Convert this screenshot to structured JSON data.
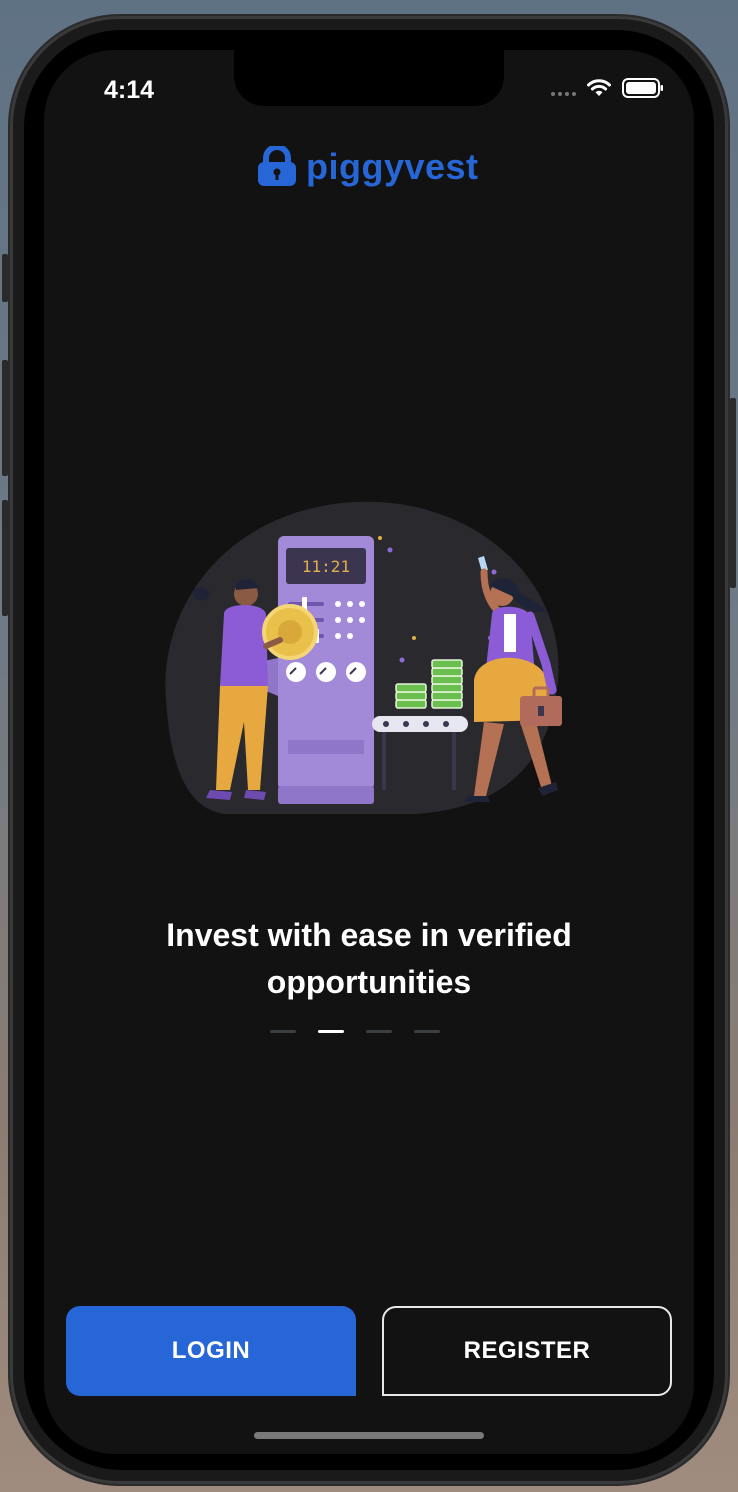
{
  "status_bar": {
    "time": "4:14",
    "icons": [
      "signal-dots-icon",
      "wifi-icon",
      "battery-icon"
    ]
  },
  "brand": {
    "name": "piggyvest",
    "logo_icon": "padlock-icon",
    "color": "#2766d6"
  },
  "onboarding": {
    "illustration": "investment-machine-illustration",
    "headline": "Invest with ease in verified opportunities",
    "page_count": 4,
    "active_page": 2
  },
  "actions": {
    "login_label": "LOGIN",
    "register_label": "REGISTER",
    "login_color": "#2766d6"
  }
}
